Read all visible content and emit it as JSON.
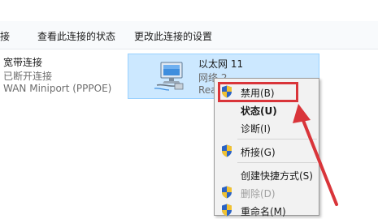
{
  "toolbar": {
    "items": [
      "连接",
      "查看此连接的状态",
      "更改此连接的设置"
    ]
  },
  "connections": {
    "broadband": {
      "name": "宽带连接",
      "status": "已断开连接",
      "device": "WAN Miniport (PPPOE)"
    },
    "ethernet": {
      "name": "以太网 11",
      "network": "网络 2",
      "device_partial": "Rea"
    }
  },
  "context_menu": {
    "items": [
      {
        "label": "禁用(B)",
        "icon": "uac-shield-icon",
        "bold": false,
        "disabled": false,
        "highlighted": true
      },
      {
        "label": "状态(U)",
        "icon": null,
        "bold": true,
        "disabled": false
      },
      {
        "label": "诊断(I)",
        "icon": null,
        "bold": false,
        "disabled": false
      },
      {
        "label": "桥接(G)",
        "icon": "uac-shield-icon",
        "bold": false,
        "disabled": false
      },
      {
        "label": "创建快捷方式(S)",
        "icon": null,
        "bold": false,
        "disabled": false
      },
      {
        "label": "删除(D)",
        "icon": "uac-shield-icon",
        "bold": false,
        "disabled": true
      },
      {
        "label": "重命名(M)",
        "icon": "uac-shield-icon",
        "bold": false,
        "disabled": false
      }
    ]
  },
  "colors": {
    "selection": "#cce8ff",
    "annotation": "#d9353a"
  }
}
